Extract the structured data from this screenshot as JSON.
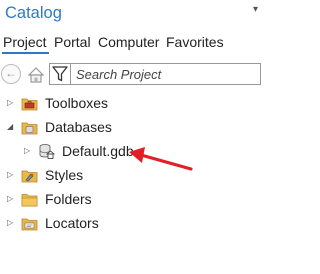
{
  "panel": {
    "title": "Catalog",
    "menu_glyph": "▾"
  },
  "tabs": [
    {
      "label": "Project",
      "active": true
    },
    {
      "label": "Portal",
      "active": false
    },
    {
      "label": "Computer",
      "active": false
    },
    {
      "label": "Favorites",
      "active": false
    }
  ],
  "toolbar": {
    "back_glyph": "←",
    "home_icon": "home-icon",
    "filter_icon": "filter-icon",
    "search_placeholder": "Search Project"
  },
  "tree": {
    "expander_collapsed": "▷",
    "expander_expanded": "◢",
    "items": [
      {
        "label": "Toolboxes",
        "icon": "toolbox-folder-icon",
        "expanded": false
      },
      {
        "label": "Databases",
        "icon": "database-folder-icon",
        "expanded": true
      },
      {
        "label": "Default.gdb",
        "icon": "geodatabase-home-icon",
        "expanded": false
      },
      {
        "label": "Styles",
        "icon": "styles-folder-icon",
        "expanded": false
      },
      {
        "label": "Folders",
        "icon": "folder-icon",
        "expanded": false
      },
      {
        "label": "Locators",
        "icon": "locator-folder-icon",
        "expanded": false
      }
    ]
  },
  "annotation": {
    "icon": "red-arrow-icon",
    "color": "#e21f26"
  },
  "colors": {
    "accent": "#2e79c7",
    "folder": "#e8b84a"
  }
}
